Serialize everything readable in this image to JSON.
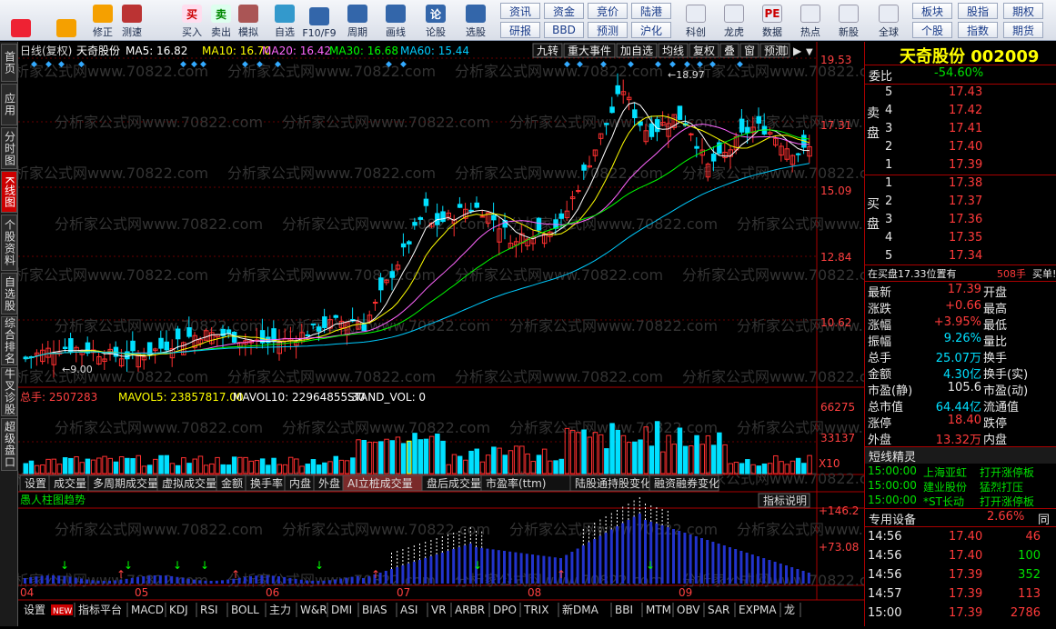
{
  "toolbar": {
    "buttons": [
      {
        "label": "",
        "icon": "windows-logo-icon"
      },
      {
        "label": "",
        "icon": "back-arrow-icon"
      },
      {
        "label": "修正",
        "icon": "up-down-arrow-icon"
      },
      {
        "label": "测速",
        "icon": "clock-icon"
      },
      {
        "label": "买入",
        "icon": "buy-icon",
        "glyph": "买"
      },
      {
        "label": "卖出",
        "icon": "sell-icon",
        "glyph": "卖"
      },
      {
        "label": "模拟",
        "icon": "gavel-icon"
      },
      {
        "label": "自选",
        "icon": "star-icon"
      },
      {
        "label": "F10/F9",
        "icon": "f10-icon"
      },
      {
        "label": "周期",
        "icon": "cycle-icon"
      },
      {
        "label": "画线",
        "icon": "pencil-icon"
      },
      {
        "label": "论股",
        "icon": "discuss-icon",
        "glyph": "论"
      },
      {
        "label": "选股",
        "icon": "magnifier-icon"
      }
    ],
    "grid": [
      "资讯",
      "资金",
      "竞价",
      "陆港",
      "研报",
      "BBD",
      "预测",
      "沪化"
    ],
    "buttons2": [
      {
        "label": "科创",
        "icon": "chart-icon"
      },
      {
        "label": "龙虎",
        "icon": "tiger-icon"
      },
      {
        "label": "数据",
        "icon": "pe-icon",
        "glyph": "PE"
      },
      {
        "label": "热点",
        "icon": "hot-icon"
      },
      {
        "label": "新股",
        "icon": "ipo-icon"
      },
      {
        "label": "全球",
        "icon": "globe-icon"
      }
    ],
    "grid2": [
      "板块",
      "股指",
      "期权",
      "个股",
      "指数",
      "期货"
    ]
  },
  "lefttabs": [
    "首页",
    "应用",
    "分时图",
    "K线图",
    "个股资料",
    "自选股",
    "综合排名",
    "牛叉诊股",
    "超级盘口"
  ],
  "chart": {
    "header_left": "日线(复权)",
    "stock": "天奇股份",
    "ma": [
      {
        "label": "MA5: 16.82",
        "color": "#ffffff"
      },
      {
        "label": "MA10: 16.70",
        "color": "#ffff00"
      },
      {
        "label": "MA20: 16.42",
        "color": "#ff66ff"
      },
      {
        "label": "MA30: 16.68",
        "color": "#00ff00"
      },
      {
        "label": "MA60: 15.44",
        "color": "#00ccff"
      }
    ],
    "top_buttons": [
      "九转",
      "重大事件",
      "加自选",
      "均线",
      "复权",
      "叠",
      "窗",
      "预测"
    ],
    "price_axis": [
      "19.53",
      "17.31",
      "15.09",
      "12.84",
      "10.62"
    ],
    "high_label": "18.97",
    "low_label": "9.00",
    "vol_header": [
      {
        "t": "总手: 2507283",
        "c": "#ff4040"
      },
      {
        "t": "MAVOL5: 23857817.00",
        "c": "#ffff00"
      },
      {
        "t": "MAVOL10: 22964855.30",
        "c": "#ffffff"
      },
      {
        "t": "STAND_VOL: 0",
        "c": "#ffffff"
      }
    ],
    "vol_axis": [
      "66275",
      "33137",
      "X10"
    ],
    "mid_tabs": [
      "设置",
      "成交量",
      "多周期成交量",
      "虚拟成交量",
      "金额",
      "换手率",
      "内盘",
      "外盘",
      "AI立桩成交量",
      "盘后成交量",
      "市盈率(ttm)",
      "陆股通持股变化",
      "融资融券变化"
    ],
    "ind_title": "愚人柱图趋势",
    "ind_button": "指标说明",
    "ind_axis": [
      "+146.2",
      "+73.08"
    ],
    "months": [
      "04",
      "05",
      "06",
      "07",
      "08",
      "09"
    ],
    "bottom_tabs": [
      "设置",
      "指标平台",
      "MACD",
      "KDJ",
      "RSI",
      "BOLL",
      "主力",
      "W&R",
      "DMI",
      "BIAS",
      "ASI",
      "VR",
      "ARBR",
      "DPO",
      "TRIX",
      "新DMA",
      "BBI",
      "MTM",
      "OBV",
      "SAR",
      "EXPMA",
      "龙"
    ],
    "new_badge": "NEW",
    "watermark": "分析家公式网www.70822.com"
  },
  "sidebar": {
    "title": "天奇股份 002009",
    "weibi": {
      "label": "委比",
      "value": "-54.60%"
    },
    "sell_label": "卖盘",
    "buy_label": "买盘",
    "sell": [
      [
        "5",
        "17.43"
      ],
      [
        "4",
        "17.42"
      ],
      [
        "3",
        "17.41"
      ],
      [
        "2",
        "17.40"
      ],
      [
        "1",
        "17.39"
      ]
    ],
    "buy": [
      [
        "1",
        "17.38"
      ],
      [
        "2",
        "17.37"
      ],
      [
        "3",
        "17.36"
      ],
      [
        "4",
        "17.35"
      ],
      [
        "5",
        "17.34"
      ]
    ],
    "notice": {
      "a": "在买盘17.33位置有",
      "b": "508手",
      "c": "买单!"
    },
    "quote": [
      [
        "最新",
        "17.39",
        "red",
        "开盘",
        ""
      ],
      [
        "涨跌",
        "+0.66",
        "red",
        "最高",
        ""
      ],
      [
        "涨幅",
        "+3.95%",
        "red",
        "最低",
        ""
      ],
      [
        "振幅",
        "9.26%",
        "cyan",
        "量比",
        ""
      ],
      [
        "总手",
        "25.07万",
        "cyan",
        "换手",
        ""
      ],
      [
        "金额",
        "4.30亿",
        "cyan",
        "换手(实)",
        ""
      ],
      [
        "市盈(静)",
        "105.6",
        "wht",
        "市盈(动)",
        ""
      ],
      [
        "总市值",
        "64.44亿",
        "cyan",
        "流通值",
        ""
      ],
      [
        "涨停",
        "18.40",
        "red",
        "跌停",
        ""
      ],
      [
        "外盘",
        "13.32万",
        "red",
        "内盘",
        ""
      ]
    ],
    "elf_title": "短线精灵",
    "elf": [
      [
        "15:00:00",
        "上海亚虹",
        "打开涨停板"
      ],
      [
        "15:00:00",
        "建业股份",
        "猛烈打压"
      ],
      [
        "15:00:00",
        "*ST长动",
        "打开涨停板"
      ]
    ],
    "equip": {
      "label": "专用设备",
      "pct": "2.66%",
      "tag": "同"
    },
    "ticks": [
      [
        "14:56",
        "17.40",
        "46"
      ],
      [
        "14:56",
        "17.40",
        "100"
      ],
      [
        "14:56",
        "17.39",
        "352"
      ],
      [
        "14:57",
        "17.39",
        "113"
      ],
      [
        "15:00",
        "17.39",
        "2786"
      ]
    ]
  }
}
